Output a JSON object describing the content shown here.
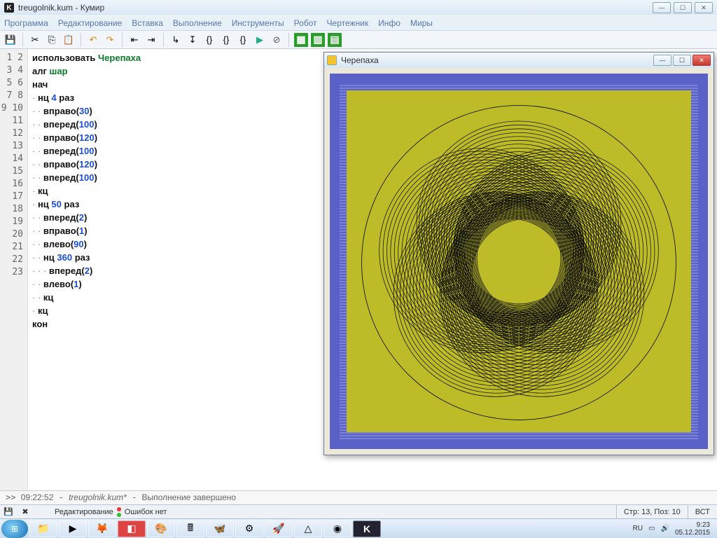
{
  "title": "treugolnik.kum - Кумир",
  "menu": [
    "Программа",
    "Редактирование",
    "Вставка",
    "Выполнение",
    "Инструменты",
    "Робот",
    "Чертежник",
    "Инфо",
    "Миры"
  ],
  "toolbar_icons": [
    "save",
    "cut",
    "copy",
    "paste",
    "undo",
    "redo",
    "|",
    "run",
    "step",
    "brace-in",
    "brace-out",
    "brace-pair",
    "play",
    "stop",
    "|",
    "grid1",
    "grid2",
    "grid3"
  ],
  "code_lines": [
    {
      "n": 1,
      "indent": 0,
      "dots": 0,
      "tokens": [
        [
          "kw",
          "использовать "
        ],
        [
          "id",
          "Черепаха"
        ]
      ]
    },
    {
      "n": 2,
      "indent": 0,
      "dots": 0,
      "tokens": [
        [
          "kw",
          "алг "
        ],
        [
          "id",
          "шар"
        ]
      ]
    },
    {
      "n": 3,
      "indent": 0,
      "dots": 0,
      "tokens": [
        [
          "kw",
          "нач"
        ]
      ]
    },
    {
      "n": 4,
      "indent": 0,
      "dots": 1,
      "tokens": [
        [
          "kw",
          "нц "
        ],
        [
          "num",
          "4"
        ],
        [
          "kw",
          " раз"
        ]
      ]
    },
    {
      "n": 5,
      "indent": 0,
      "dots": 2,
      "tokens": [
        [
          "kw",
          "вправо"
        ],
        [
          "pun",
          "("
        ],
        [
          "num",
          "30"
        ],
        [
          "pun",
          ")"
        ]
      ]
    },
    {
      "n": 6,
      "indent": 0,
      "dots": 2,
      "tokens": [
        [
          "kw",
          "вперед"
        ],
        [
          "pun",
          "("
        ],
        [
          "num",
          "100"
        ],
        [
          "pun",
          ")"
        ]
      ]
    },
    {
      "n": 7,
      "indent": 0,
      "dots": 2,
      "tokens": [
        [
          "kw",
          "вправо"
        ],
        [
          "pun",
          "("
        ],
        [
          "num",
          "120"
        ],
        [
          "pun",
          ")"
        ]
      ]
    },
    {
      "n": 8,
      "indent": 0,
      "dots": 2,
      "tokens": [
        [
          "kw",
          "вперед"
        ],
        [
          "pun",
          "("
        ],
        [
          "num",
          "100"
        ],
        [
          "pun",
          ")"
        ]
      ]
    },
    {
      "n": 9,
      "indent": 0,
      "dots": 2,
      "tokens": [
        [
          "kw",
          "вправо"
        ],
        [
          "pun",
          "("
        ],
        [
          "num",
          "120"
        ],
        [
          "pun",
          ")"
        ]
      ]
    },
    {
      "n": 10,
      "indent": 0,
      "dots": 2,
      "tokens": [
        [
          "kw",
          "вперед"
        ],
        [
          "pun",
          "("
        ],
        [
          "num",
          "100"
        ],
        [
          "pun",
          ")"
        ]
      ]
    },
    {
      "n": 11,
      "indent": 0,
      "dots": 1,
      "tokens": [
        [
          "kw",
          "кц"
        ]
      ]
    },
    {
      "n": 12,
      "indent": 0,
      "dots": 1,
      "tokens": [
        [
          "kw",
          "нц "
        ],
        [
          "num",
          "50"
        ],
        [
          "kw",
          " раз"
        ]
      ]
    },
    {
      "n": 13,
      "indent": 0,
      "dots": 2,
      "tokens": [
        [
          "kw",
          "вперед"
        ],
        [
          "pun",
          "("
        ],
        [
          "num",
          "2"
        ],
        [
          "pun",
          ")"
        ]
      ]
    },
    {
      "n": 14,
      "indent": 0,
      "dots": 2,
      "tokens": [
        [
          "kw",
          "вправо"
        ],
        [
          "pun",
          "("
        ],
        [
          "num",
          "1"
        ],
        [
          "pun",
          ")"
        ]
      ]
    },
    {
      "n": 15,
      "indent": 0,
      "dots": 2,
      "tokens": [
        [
          "kw",
          "влево"
        ],
        [
          "pun",
          "("
        ],
        [
          "num",
          "90"
        ],
        [
          "pun",
          ")"
        ]
      ]
    },
    {
      "n": 16,
      "indent": 0,
      "dots": 2,
      "tokens": [
        [
          "kw",
          "нц "
        ],
        [
          "num",
          "360"
        ],
        [
          "kw",
          " раз"
        ]
      ]
    },
    {
      "n": 17,
      "indent": 0,
      "dots": 3,
      "tokens": [
        [
          "kw",
          "вперед"
        ],
        [
          "pun",
          "("
        ],
        [
          "num",
          "2"
        ],
        [
          "pun",
          ")"
        ]
      ]
    },
    {
      "n": 18,
      "indent": 0,
      "dots": 2,
      "tokens": [
        [
          "kw",
          "влево"
        ],
        [
          "pun",
          "("
        ],
        [
          "num",
          "1"
        ],
        [
          "pun",
          ")"
        ]
      ]
    },
    {
      "n": 19,
      "indent": 0,
      "dots": 2,
      "tokens": [
        [
          "kw",
          "кц"
        ]
      ]
    },
    {
      "n": 20,
      "indent": 0,
      "dots": 1,
      "tokens": [
        [
          "kw",
          "кц"
        ]
      ]
    },
    {
      "n": 21,
      "indent": 0,
      "dots": 0,
      "tokens": [
        [
          "kw",
          "кон"
        ]
      ]
    },
    {
      "n": 22,
      "indent": 0,
      "dots": 0,
      "tokens": []
    },
    {
      "n": 23,
      "indent": 0,
      "dots": 0,
      "tokens": []
    }
  ],
  "console": {
    "time": "09:22:52",
    "file": "treugolnik.kum*",
    "msg": "Выполнение завершено"
  },
  "status": {
    "mode": "Редактирование",
    "errors": "Ошибок нет",
    "cursor": "Стр: 13, Поз: 10",
    "ins": "ВСТ"
  },
  "turtle": {
    "title": "Черепаха",
    "ring_count": 20,
    "lobes": 5,
    "radius": 115
  },
  "taskbar": {
    "lang": "RU",
    "time": "9:23",
    "date": "05.12.2015"
  }
}
